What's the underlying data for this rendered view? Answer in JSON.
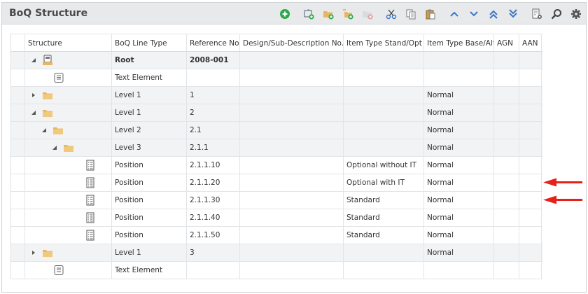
{
  "title": "BoQ Structure",
  "colors": {
    "accent_green": "#2fa84f",
    "toolbar_blue": "#3b76c4",
    "folder": "#e8b562",
    "red_arrow": "#e8201a"
  },
  "toolbar_icons": [
    "add-icon",
    "add-root-icon",
    "add-folder-icon",
    "add-subfolder-icon",
    "delete-folder-icon",
    "cut-icon",
    "copy-icon",
    "paste-icon",
    "move-up-icon",
    "move-down-icon",
    "move-top-icon",
    "move-bottom-icon",
    "settings-list-icon",
    "search-icon",
    "gear-icon"
  ],
  "columns": [
    "Structure",
    "BoQ Line Type",
    "Reference No.",
    "Design/Sub-Description No.",
    "Item Type Stand/Opt",
    "Item Type Base/Alt",
    "AGN",
    "AAN"
  ],
  "rows": [
    {
      "level": 0,
      "expand": "open",
      "icon": "root-icon",
      "line_type": "Root",
      "ref": "2008-001",
      "stand_opt": "",
      "base_alt": "",
      "bold": true,
      "shade": true
    },
    {
      "level": 1,
      "expand": "none",
      "icon": "text-icon",
      "line_type": "Text Element",
      "ref": "",
      "stand_opt": "",
      "base_alt": "",
      "bold": false,
      "shade": false
    },
    {
      "level": 0,
      "expand": "closed",
      "icon": "folder-icon",
      "line_type": "Level 1",
      "ref": "1",
      "stand_opt": "",
      "base_alt": "Normal",
      "bold": false,
      "shade": true
    },
    {
      "level": 0,
      "expand": "open",
      "icon": "folder-icon",
      "line_type": "Level 1",
      "ref": "2",
      "stand_opt": "",
      "base_alt": "Normal",
      "bold": false,
      "shade": true
    },
    {
      "level": 1,
      "expand": "open",
      "icon": "folder-icon",
      "line_type": "Level 2",
      "ref": "2.1",
      "stand_opt": "",
      "base_alt": "Normal",
      "bold": false,
      "shade": true
    },
    {
      "level": 2,
      "expand": "open",
      "icon": "folder-icon",
      "line_type": "Level 3",
      "ref": "2.1.1",
      "stand_opt": "",
      "base_alt": "Normal",
      "bold": false,
      "shade": true
    },
    {
      "level": 3,
      "expand": "none",
      "icon": "position-icon",
      "line_type": "Position",
      "ref": "2.1.1.10",
      "stand_opt": "Optional without IT",
      "base_alt": "Normal",
      "bold": false,
      "shade": false
    },
    {
      "level": 3,
      "expand": "none",
      "icon": "position-icon",
      "line_type": "Position",
      "ref": "2.1.1.20",
      "stand_opt": "Optional with IT",
      "base_alt": "Normal",
      "bold": false,
      "shade": false
    },
    {
      "level": 3,
      "expand": "none",
      "icon": "position-icon",
      "line_type": "Position",
      "ref": "2.1.1.30",
      "stand_opt": "Standard",
      "base_alt": "Normal",
      "bold": false,
      "shade": false
    },
    {
      "level": 3,
      "expand": "none",
      "icon": "position-icon",
      "line_type": "Position",
      "ref": "2.1.1.40",
      "stand_opt": "Standard",
      "base_alt": "Normal",
      "bold": false,
      "shade": false
    },
    {
      "level": 3,
      "expand": "none",
      "icon": "position-icon",
      "line_type": "Position",
      "ref": "2.1.1.50",
      "stand_opt": "Standard",
      "base_alt": "Normal",
      "bold": false,
      "shade": false
    },
    {
      "level": 0,
      "expand": "closed",
      "icon": "folder-icon",
      "line_type": "Level 1",
      "ref": "3",
      "stand_opt": "",
      "base_alt": "Normal",
      "bold": false,
      "shade": true
    },
    {
      "level": 1,
      "expand": "none",
      "icon": "text-icon",
      "line_type": "Text Element",
      "ref": "",
      "stand_opt": "",
      "base_alt": "",
      "bold": false,
      "shade": false
    }
  ],
  "annotation_arrows": [
    "row-7",
    "row-8"
  ]
}
